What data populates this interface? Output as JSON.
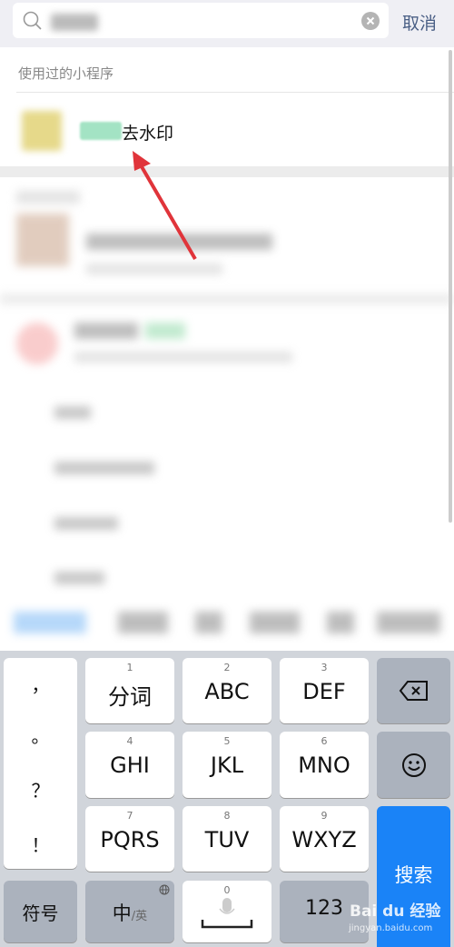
{
  "search": {
    "cancel": "取消"
  },
  "used_section": {
    "title": "使用过的小程序",
    "item_suffix": "去水印"
  },
  "keyboard": {
    "punct": [
      "，",
      "。",
      "？",
      "！"
    ],
    "keys": [
      {
        "num": "1",
        "label": "分词"
      },
      {
        "num": "2",
        "label": "ABC"
      },
      {
        "num": "3",
        "label": "DEF"
      },
      {
        "num": "4",
        "label": "GHI"
      },
      {
        "num": "5",
        "label": "JKL"
      },
      {
        "num": "6",
        "label": "MNO"
      },
      {
        "num": "7",
        "label": "PQRS"
      },
      {
        "num": "8",
        "label": "TUV"
      },
      {
        "num": "9",
        "label": "WXYZ"
      }
    ],
    "symbols": "符号",
    "lang_main": "中",
    "lang_sub": "/英",
    "space_num": "0",
    "num_mode": "123",
    "search": "搜索"
  },
  "watermark": {
    "brand": "Bai du 经验",
    "url": "jingyan.baidu.com"
  },
  "colors": {
    "accent": "#1a83f7",
    "arrow": "#e0343a"
  }
}
